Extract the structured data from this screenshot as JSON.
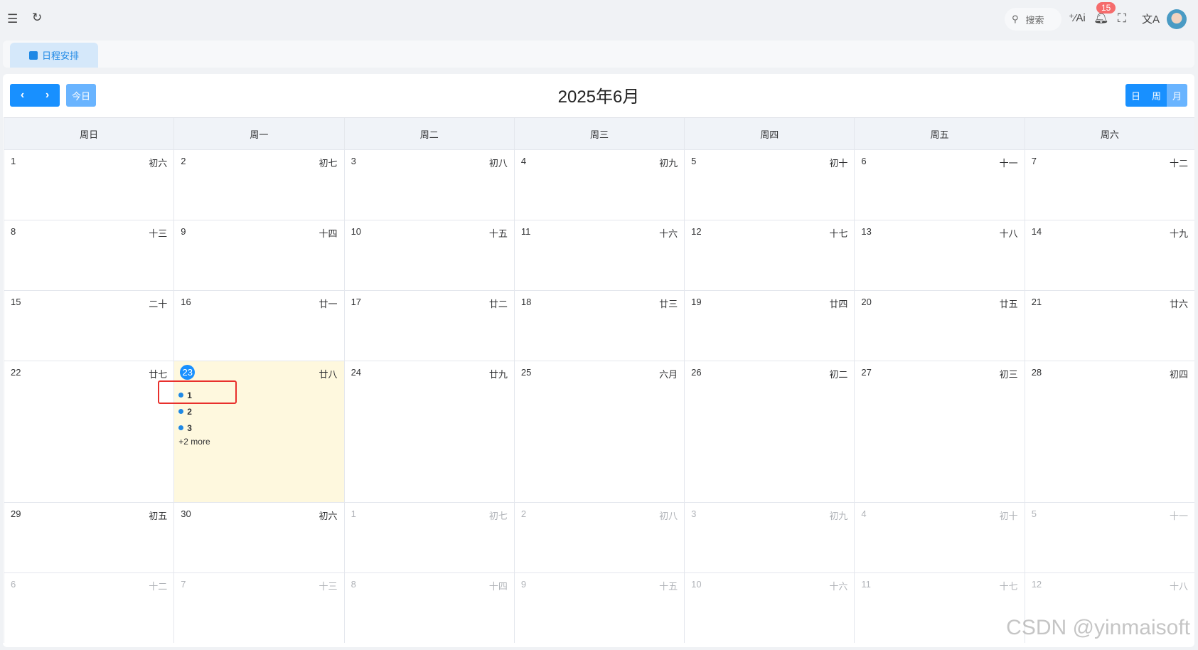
{
  "header": {
    "search_label": "搜索",
    "notification_count": "15"
  },
  "tab": {
    "label": "日程安排"
  },
  "toolbar": {
    "prev": "‹",
    "next": "›",
    "today": "今日",
    "title": "2025年6月",
    "views": [
      "日",
      "周",
      "月"
    ],
    "active_view": "月"
  },
  "weekdays": [
    "周日",
    "周一",
    "周二",
    "周三",
    "周四",
    "周五",
    "周六"
  ],
  "weeks": [
    [
      {
        "d": "1",
        "l": "初六"
      },
      {
        "d": "2",
        "l": "初七"
      },
      {
        "d": "3",
        "l": "初八"
      },
      {
        "d": "4",
        "l": "初九"
      },
      {
        "d": "5",
        "l": "初十"
      },
      {
        "d": "6",
        "l": "十一"
      },
      {
        "d": "7",
        "l": "十二"
      }
    ],
    [
      {
        "d": "8",
        "l": "十三"
      },
      {
        "d": "9",
        "l": "十四"
      },
      {
        "d": "10",
        "l": "十五"
      },
      {
        "d": "11",
        "l": "十六"
      },
      {
        "d": "12",
        "l": "十七"
      },
      {
        "d": "13",
        "l": "十八"
      },
      {
        "d": "14",
        "l": "十九"
      }
    ],
    [
      {
        "d": "15",
        "l": "二十"
      },
      {
        "d": "16",
        "l": "廿一"
      },
      {
        "d": "17",
        "l": "廿二"
      },
      {
        "d": "18",
        "l": "廿三"
      },
      {
        "d": "19",
        "l": "廿四"
      },
      {
        "d": "20",
        "l": "廿五"
      },
      {
        "d": "21",
        "l": "廿六"
      }
    ],
    [
      {
        "d": "22",
        "l": "廿七"
      },
      {
        "d": "23",
        "l": "廿八",
        "today": true,
        "events": [
          "1",
          "2",
          "3"
        ],
        "more": "+2 more"
      },
      {
        "d": "24",
        "l": "廿九"
      },
      {
        "d": "25",
        "l": "六月"
      },
      {
        "d": "26",
        "l": "初二"
      },
      {
        "d": "27",
        "l": "初三"
      },
      {
        "d": "28",
        "l": "初四"
      }
    ],
    [
      {
        "d": "29",
        "l": "初五"
      },
      {
        "d": "30",
        "l": "初六"
      },
      {
        "d": "1",
        "l": "初七",
        "other": true
      },
      {
        "d": "2",
        "l": "初八",
        "other": true
      },
      {
        "d": "3",
        "l": "初九",
        "other": true
      },
      {
        "d": "4",
        "l": "初十",
        "other": true
      },
      {
        "d": "5",
        "l": "十一",
        "other": true
      }
    ],
    [
      {
        "d": "6",
        "l": "十二",
        "other": true
      },
      {
        "d": "7",
        "l": "十三",
        "other": true
      },
      {
        "d": "8",
        "l": "十四",
        "other": true
      },
      {
        "d": "9",
        "l": "十五",
        "other": true
      },
      {
        "d": "10",
        "l": "十六",
        "other": true
      },
      {
        "d": "11",
        "l": "十七",
        "other": true
      },
      {
        "d": "12",
        "l": "十八",
        "other": true
      }
    ]
  ],
  "watermark": "CSDN @yinmaisoft"
}
